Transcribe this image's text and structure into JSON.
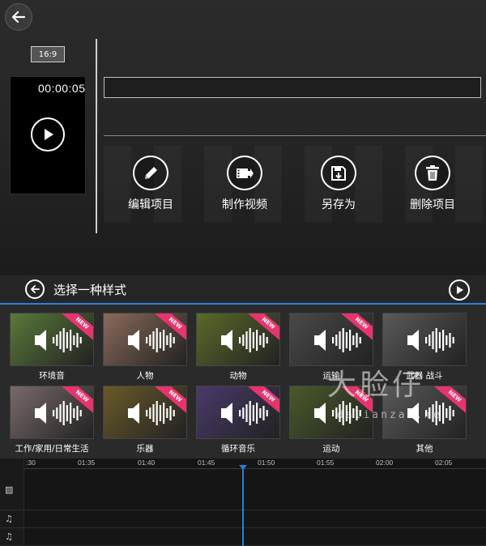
{
  "header": {
    "back_icon": "arrow-left-icon",
    "aspect_ratio": "16:9"
  },
  "preview": {
    "timecode": "00:00:05",
    "play_icon": "play-icon"
  },
  "project_title": {
    "value": ""
  },
  "actions": [
    {
      "label": "编辑项目",
      "icon": "pencil-icon"
    },
    {
      "label": "制作视频",
      "icon": "film-export-icon"
    },
    {
      "label": "另存为",
      "icon": "save-icon"
    },
    {
      "label": "删除项目",
      "icon": "trash-icon"
    }
  ],
  "style_bar": {
    "title": "选择一种样式",
    "back_icon": "arrow-left-circle-icon",
    "play_icon": "play-circle-icon"
  },
  "styles": [
    {
      "label": "环境音",
      "badge": "NEW",
      "tint": "#5a7a3a"
    },
    {
      "label": "人物",
      "badge": "NEW",
      "tint": "#8a6a5a"
    },
    {
      "label": "动物",
      "badge": "NEW",
      "tint": "#5a6a2a"
    },
    {
      "label": "运输",
      "badge": "NEW",
      "tint": "#4a4a4a"
    },
    {
      "label": "武器 战斗",
      "badge": "",
      "tint": "#5a5a5a"
    },
    {
      "label": "工作/家用/日常生活",
      "badge": "NEW",
      "tint": "#7a6a6a"
    },
    {
      "label": "乐器",
      "badge": "NEW",
      "tint": "#6a5a2a"
    },
    {
      "label": "循环音乐",
      "badge": "NEW",
      "tint": "#4a3a6a"
    },
    {
      "label": "运动",
      "badge": "NEW",
      "tint": "#4a5a2a"
    },
    {
      "label": "其他",
      "badge": "NEW",
      "tint": "#5a5a5a"
    }
  ],
  "watermark": {
    "main": "大脸仔",
    "sub": "dalianzai.me"
  },
  "timeline": {
    "ticks": [
      ":30",
      "01:35",
      "01:40",
      "01:45",
      "01:50",
      "01:55",
      "02:00",
      "02:05"
    ],
    "track_icons": [
      "image-icon",
      "music-note-icon",
      "music-note-icon"
    ],
    "track_glyphs": [
      "▨",
      "♫",
      "♫"
    ]
  },
  "colors": {
    "accent": "#2a7fd4",
    "badge": "#e8346e"
  }
}
